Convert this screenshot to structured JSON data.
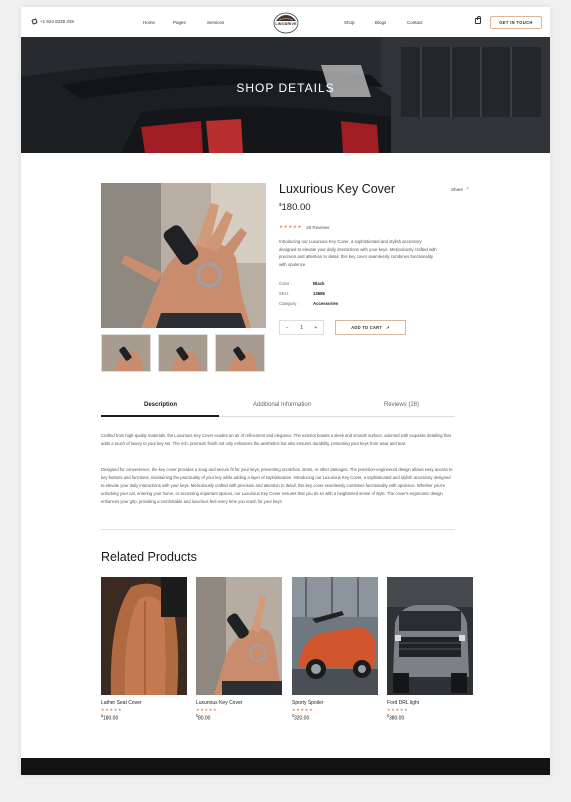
{
  "header": {
    "phone": "+1 924 8326 339",
    "nav_left": [
      "Home",
      "Pages",
      "Services"
    ],
    "nav_right": [
      "Shop",
      "Blogs",
      "Contact"
    ],
    "logo_text": "LINODRIVE",
    "cta_label": "GET IN TOUCH"
  },
  "hero": {
    "title": "SHOP DETAILS"
  },
  "product": {
    "title": "Luxurious Key Cover",
    "share_label": "Share",
    "price_currency": "$",
    "price_value": "180.00",
    "stars": "★★★★★",
    "reviews_label": "28 Reviews",
    "description": "Introducing our Luxurious Key Cover, a sophisticated and stylish accessory designed to elevate your daily interactions with your keys. Meticulously crafted with precision and attention to detail, this key cover seamlessly combines functionality with opulence.",
    "meta": [
      {
        "label": "Color :",
        "value": "Black"
      },
      {
        "label": "SKU :",
        "value": "13686"
      },
      {
        "label": "Category :",
        "value": "Accessories"
      }
    ],
    "qty_minus": "−",
    "qty_value": "1",
    "qty_plus": "+",
    "add_to_cart_label": "ADD TO CART"
  },
  "tabs": [
    "Description",
    "Additional Information",
    "Reviews (28)"
  ],
  "long_description": [
    "Crafted from high-quality materials, the Luxurious Key Cover exudes an air of refinement and elegance. The exterior boasts a sleek and smooth surface, adorned with exquisite detailing that adds a touch of luxury to your key set. The rich, premium finish not only enhances the aesthetics but also ensures durability, protecting your keys from wear and tear.",
    "Designed for convenience, the key cover provides a snug and secure fit for your keys, preventing scratches, dents, or other damages. The precision-engineered design allows easy access to key buttons and functions, maintaining the practicality of your key while adding a layer of sophistication. Introducing our Luxurious Key Cover, a sophisticated and stylish accessory designed to elevate your daily interactions with your keys. Meticulously crafted with precision and attention to detail, this key cover seamlessly combines functionality with opulence. Whether you're unlocking your car, entering your home, or accessing important spaces, our Luxurious Key Cover ensures that you do so with a heightened sense of style. The cover's ergonomic design enhances your grip, providing a comfortable and luxurious feel every time you reach for your keys."
  ],
  "related": {
    "title": "Related Products",
    "items": [
      {
        "name": "Lather Seat Cover",
        "stars": "★★★★★",
        "currency": "$",
        "price": "180.00"
      },
      {
        "name": "Luxurious Key Cover",
        "stars": "★★★★★",
        "currency": "$",
        "price": "80.00"
      },
      {
        "name": "Sporty Spoiler",
        "stars": "★★★★★",
        "currency": "$",
        "price": "320.00"
      },
      {
        "name": "Ford DRL light",
        "stars": "★★★★★",
        "currency": "$",
        "price": "380.00"
      }
    ]
  },
  "colors": {
    "accent": "#e48a54",
    "border_accent": "#d9b89e",
    "dark": "#111315"
  }
}
